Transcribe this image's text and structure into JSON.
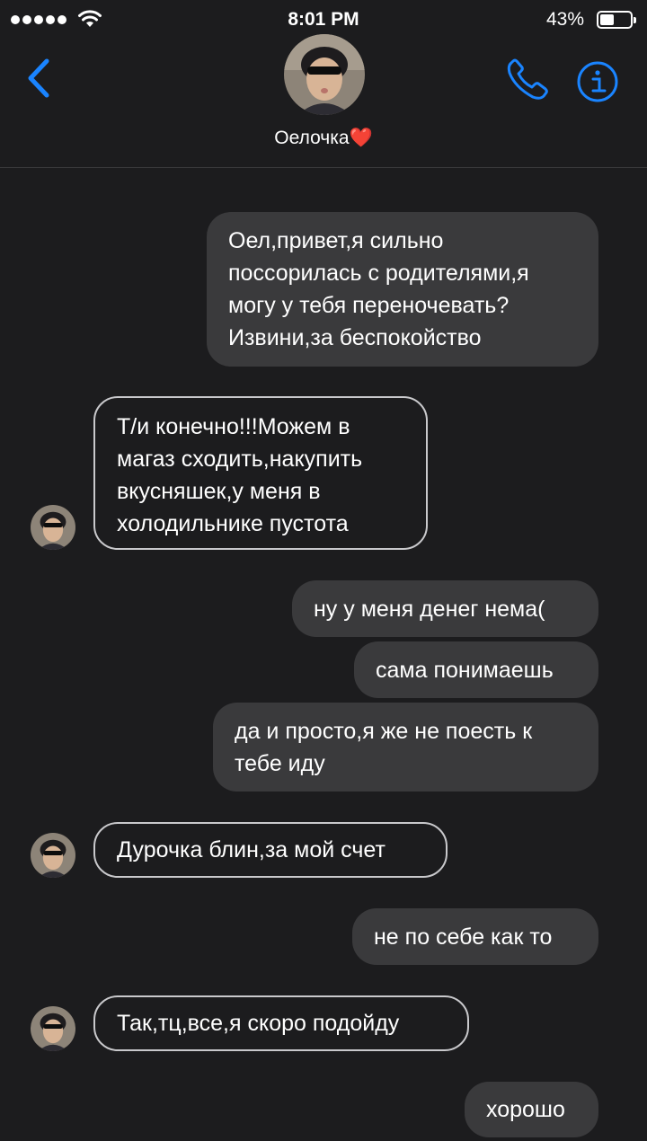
{
  "status_bar": {
    "time": "8:01 PM",
    "battery_percent": "43%",
    "battery_level": 0.43,
    "signal_icon": "signal-dots-icon",
    "wifi_icon": "wifi-icon"
  },
  "header": {
    "contact_name": "Оелочка❤️",
    "back_icon": "chevron-left-icon",
    "call_icon": "phone-icon",
    "info_icon": "info-icon",
    "accent_color": "#1a84ff"
  },
  "messages": [
    {
      "direction": "outgoing",
      "text": "Оел,привет,я сильно\nпоссорилась с родителями,я\nмогу у тебя переночевать?\nИзвини,за беспокойство"
    },
    {
      "direction": "incoming",
      "text": "Т/и конечно!!!Можем в\nмагаз сходить,накупить\nвкусняшек,у меня в\nхолодильнике пустота"
    },
    {
      "direction": "outgoing",
      "text": "ну у меня денег нема("
    },
    {
      "direction": "outgoing",
      "text": "сама понимаешь"
    },
    {
      "direction": "outgoing",
      "text": "да и просто,я же не поесть к\nтебе иду"
    },
    {
      "direction": "incoming",
      "text": "Дурочка блин,за мой счет"
    },
    {
      "direction": "outgoing",
      "text": "не по себе как то"
    },
    {
      "direction": "incoming",
      "text": "Так,тц,все,я скоро подойду"
    },
    {
      "direction": "outgoing",
      "text": "хорошо"
    }
  ],
  "colors": {
    "background": "#1c1c1e",
    "outgoing_bubble": "#3a3a3c",
    "incoming_border": "#c9c9cc"
  }
}
